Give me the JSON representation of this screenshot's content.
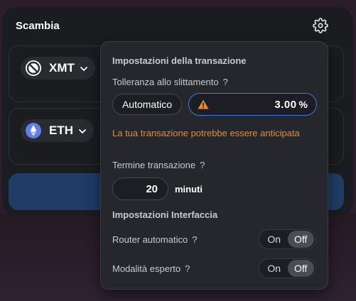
{
  "swap": {
    "title": "Scambia",
    "from_token": "XMT",
    "to_token": "ETH"
  },
  "icons": {
    "settings": "gear-icon",
    "from_token": "blocked-circle-icon",
    "to_token": "ethereum-icon",
    "chevron": "chevron-down-icon",
    "warning": "warning-triangle-icon"
  },
  "settings": {
    "title": "Impostazioni della transazione",
    "slippage": {
      "label": "Tolleranza allo slittamento",
      "help": "?",
      "auto_label": "Automatico",
      "value": "3.00",
      "unit": "%",
      "warning": "La tua transazione potrebbe essere anticipata"
    },
    "deadline": {
      "label": "Termine transazione",
      "help": "?",
      "value": "20",
      "unit": "minuti"
    },
    "interface_title": "Impostazioni Interfaccia",
    "auto_router": {
      "label": "Router automatico",
      "help": "?",
      "on_label": "On",
      "off_label": "Off",
      "selected": "Off"
    },
    "expert_mode": {
      "label": "Modalità esperto",
      "help": "?",
      "on_label": "On",
      "off_label": "Off",
      "selected": "Off"
    }
  },
  "colors": {
    "warning": "#e98a2b",
    "accent": "#3f7ae0",
    "panel": "#26272d",
    "card": "#1b1c20"
  }
}
